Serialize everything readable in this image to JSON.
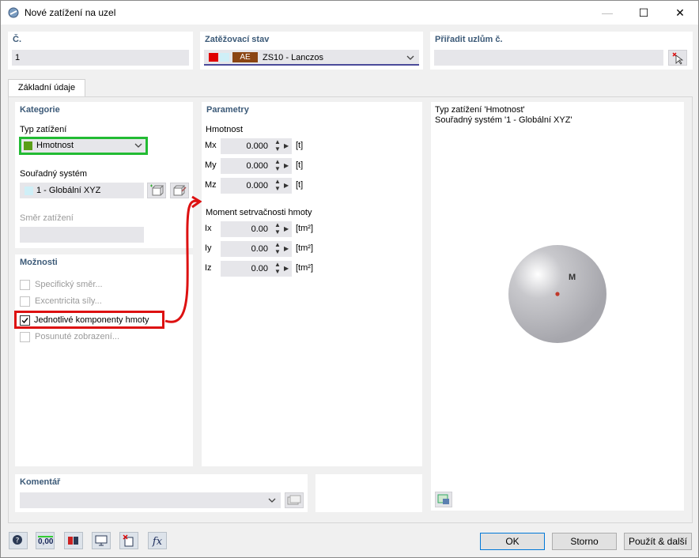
{
  "window": {
    "title": "Nové zatížení na uzel",
    "minimize": "—",
    "maximize": "☐",
    "close": "✕"
  },
  "header": {
    "number_label": "Č.",
    "number_value": "1",
    "loadcase_label": "Zatěžovací stav",
    "loadcase_code": "AE",
    "loadcase_value": "ZS10 - Lanczos",
    "loadcase_color": "#e00000",
    "loadcase_code_color": "#8b4513",
    "assign_label": "Přiřadit uzlům č.",
    "assign_value": ""
  },
  "tabs": [
    {
      "label": "Základní údaje"
    }
  ],
  "category": {
    "title": "Kategorie",
    "load_type_label": "Typ zatížení",
    "load_type_value": "Hmotnost",
    "load_type_color": "#5a9e18",
    "coord_label": "Souřadný systém",
    "coord_value": "1 - Globální XYZ",
    "direction_label": "Směr zatížení"
  },
  "options": {
    "title": "Možnosti",
    "items": [
      {
        "label": "Specifický směr...",
        "checked": false,
        "enabled": false
      },
      {
        "label": "Excentricita síly...",
        "checked": false,
        "enabled": false
      },
      {
        "label": "Jednotlivé komponenty hmoty",
        "checked": true,
        "enabled": true
      },
      {
        "label": "Posunuté zobrazení...",
        "checked": false,
        "enabled": false
      }
    ]
  },
  "parameters": {
    "title": "Parametry",
    "mass_title": "Hmotnost",
    "mass": [
      {
        "name": "Mx",
        "value": "0.000",
        "unit": "[t]"
      },
      {
        "name": "My",
        "value": "0.000",
        "unit": "[t]"
      },
      {
        "name": "Mz",
        "value": "0.000",
        "unit": "[t]"
      }
    ],
    "inertia_title": "Moment setrvačnosti hmoty",
    "inertia": [
      {
        "name": "Ix",
        "value": "0.00",
        "unit": "[tm²]"
      },
      {
        "name": "Iy",
        "value": "0.00",
        "unit": "[tm²]"
      },
      {
        "name": "Iz",
        "value": "0.00",
        "unit": "[tm²]"
      }
    ]
  },
  "preview": {
    "line1": "Typ zatížení 'Hmotnost'",
    "line2": "Souřadný systém '1 - Globální XYZ'",
    "mass_label": "M"
  },
  "comment": {
    "label": "Komentář",
    "value": ""
  },
  "buttons": {
    "ok": "OK",
    "cancel": "Storno",
    "apply_next": "Použít & další"
  },
  "toolbar": {
    "units_label": "0,00"
  },
  "highlight": {
    "green": "#22bb33",
    "red": "#dd1111"
  }
}
